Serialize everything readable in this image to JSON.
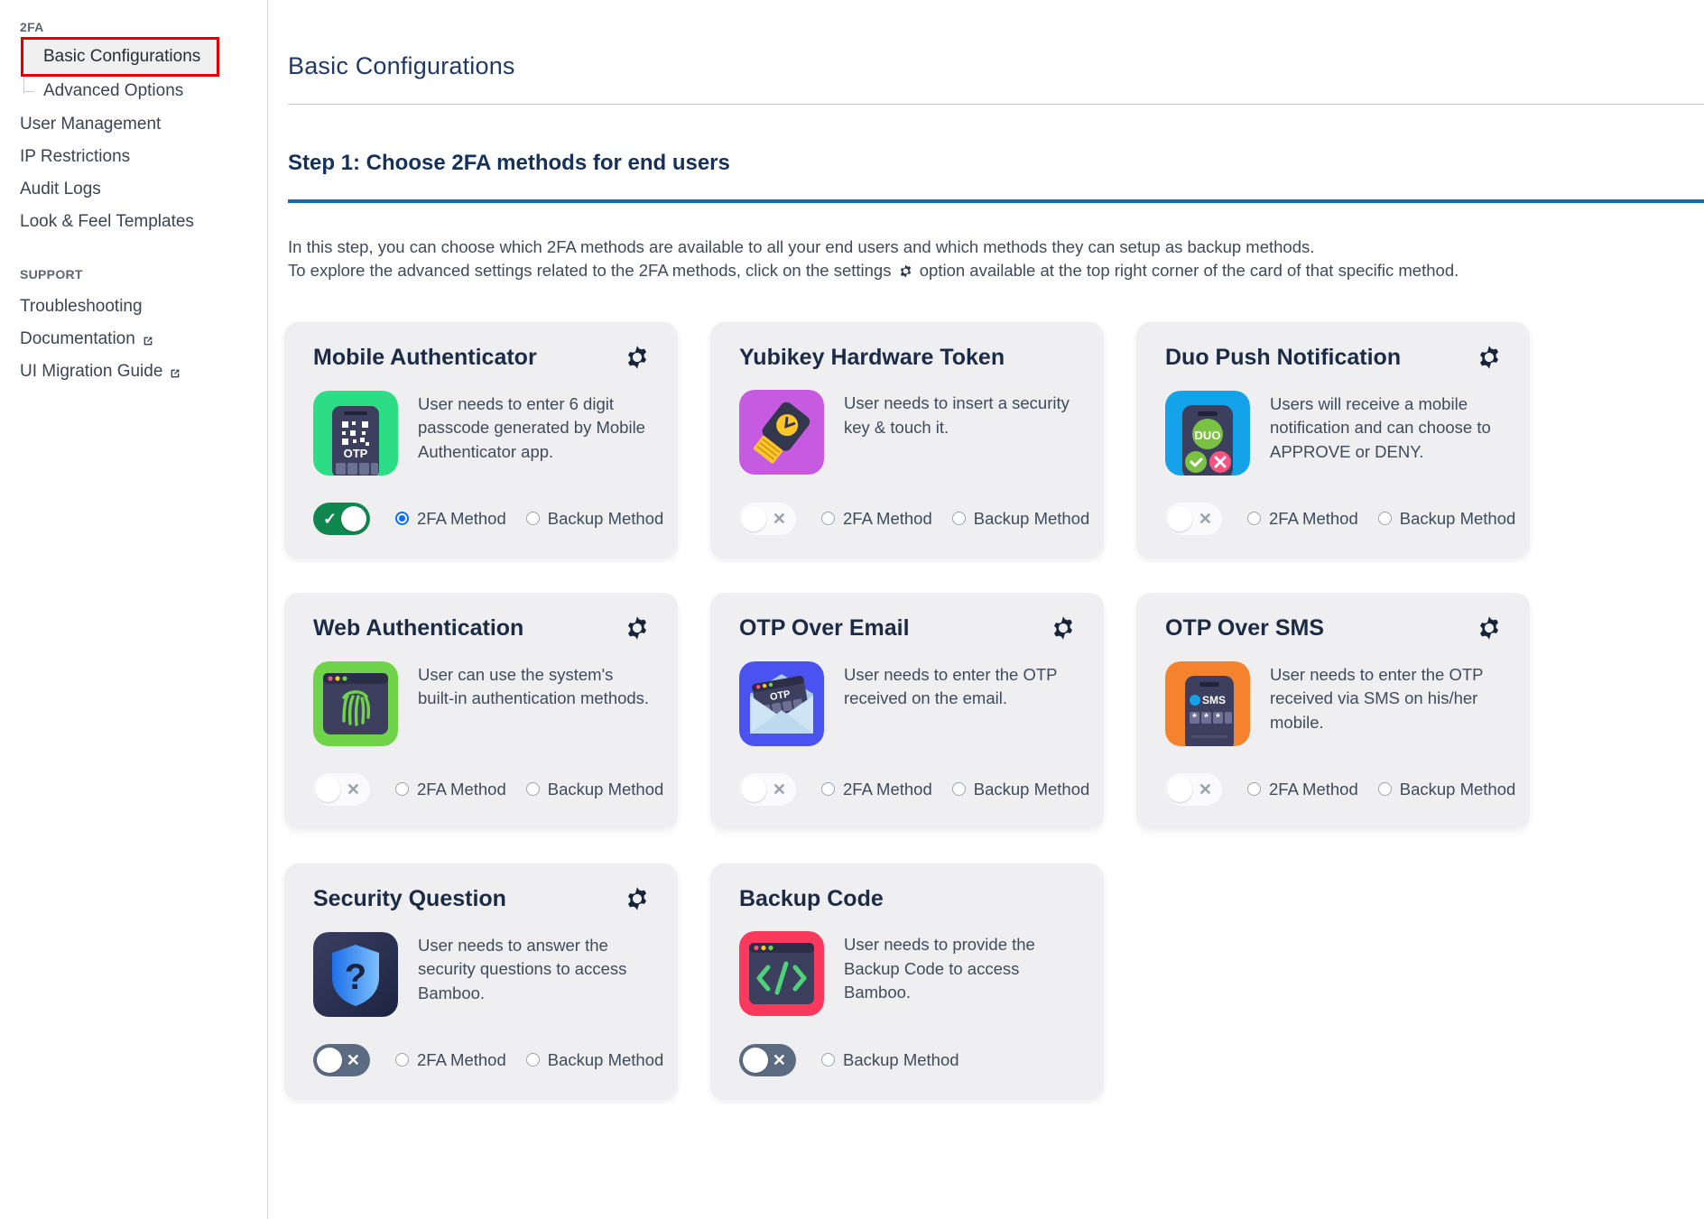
{
  "sidebar": {
    "group_label": "2FA",
    "support_label": "SUPPORT",
    "sub_items": [
      {
        "label": "Basic Configurations",
        "active": true
      },
      {
        "label": "Advanced Options",
        "active": false
      }
    ],
    "items": [
      {
        "label": "User Management",
        "external": false
      },
      {
        "label": "IP Restrictions",
        "external": false
      },
      {
        "label": "Audit Logs",
        "external": false
      },
      {
        "label": "Look & Feel Templates",
        "external": false
      }
    ],
    "support_items": [
      {
        "label": "Troubleshooting",
        "external": false
      },
      {
        "label": "Documentation",
        "external": true
      },
      {
        "label": "UI Migration Guide",
        "external": true
      }
    ]
  },
  "main": {
    "page_title": "Basic Configurations",
    "step_title": "Step 1: Choose 2FA methods for end users",
    "intro_line1": "In this step, you can choose which 2FA methods are available to all your end users and which methods they can setup as backup methods.",
    "intro_line2_a": "To explore the advanced settings related to the 2FA methods, click on the settings",
    "intro_line2_b": "option available at the top right corner of the card of that specific method."
  },
  "labels": {
    "method_2fa": "2FA Method",
    "method_backup": "Backup Method"
  },
  "colors": {
    "accent_blue": "#0f6cbd",
    "title_navy": "#13315c",
    "toggle_on_green": "#10874f",
    "toggle_off_slate": "#5b6b81",
    "radio_blue": "#0d6efd",
    "card_bg": "#efeff2",
    "annotation_red": "#e00000"
  },
  "cards": [
    {
      "title": "Mobile Authenticator",
      "description": "User needs to enter 6 digit passcode generated by Mobile Authenticator app.",
      "has_gear": true,
      "gear_icon": "gear-icon",
      "thumb_icon": "mobile-otp-icon",
      "toggle_state": "on",
      "toggle_mark": "✓",
      "radios": [
        {
          "label": "2FA Method",
          "checked": true
        },
        {
          "label": "Backup Method",
          "checked": false
        }
      ]
    },
    {
      "title": "Yubikey Hardware Token",
      "description": "User needs to insert a security key & touch it.",
      "has_gear": false,
      "gear_icon": "",
      "thumb_icon": "yubikey-token-icon",
      "toggle_state": "off-light",
      "toggle_mark": "✕",
      "radios": [
        {
          "label": "2FA Method",
          "checked": false
        },
        {
          "label": "Backup Method",
          "checked": false
        }
      ]
    },
    {
      "title": "Duo Push Notification",
      "description": "Users will receive a mobile notification and can choose to APPROVE or DENY.",
      "has_gear": true,
      "gear_icon": "gear-icon",
      "thumb_icon": "duo-push-icon",
      "toggle_state": "off-light",
      "toggle_mark": "✕",
      "radios": [
        {
          "label": "2FA Method",
          "checked": false
        },
        {
          "label": "Backup Method",
          "checked": false
        }
      ]
    },
    {
      "title": "Web Authentication",
      "description": "User can use the system's built-in authentication methods.",
      "has_gear": true,
      "gear_icon": "gear-icon",
      "thumb_icon": "fingerprint-window-icon",
      "toggle_state": "off-light",
      "toggle_mark": "✕",
      "radios": [
        {
          "label": "2FA Method",
          "checked": false
        },
        {
          "label": "Backup Method",
          "checked": false
        }
      ]
    },
    {
      "title": "OTP Over Email",
      "description": "User needs to enter the OTP received on the email.",
      "has_gear": true,
      "gear_icon": "gear-icon",
      "thumb_icon": "email-otp-icon",
      "toggle_state": "off-light",
      "toggle_mark": "✕",
      "radios": [
        {
          "label": "2FA Method",
          "checked": false
        },
        {
          "label": "Backup Method",
          "checked": false
        }
      ]
    },
    {
      "title": "OTP Over SMS",
      "description": "User needs to enter the OTP received via SMS on his/her mobile.",
      "has_gear": true,
      "gear_icon": "gear-icon",
      "thumb_icon": "sms-otp-icon",
      "toggle_state": "off-light",
      "toggle_mark": "✕",
      "radios": [
        {
          "label": "2FA Method",
          "checked": false
        },
        {
          "label": "Backup Method",
          "checked": false
        }
      ]
    },
    {
      "title": "Security Question",
      "description": "User needs to answer the security questions to access Bamboo.",
      "has_gear": true,
      "gear_icon": "gear-icon",
      "thumb_icon": "shield-question-icon",
      "toggle_state": "off-dark",
      "toggle_mark": "✕",
      "radios": [
        {
          "label": "2FA Method",
          "checked": false
        },
        {
          "label": "Backup Method",
          "checked": false
        }
      ]
    },
    {
      "title": "Backup Code",
      "description": "User needs to provide the Backup Code to access Bamboo.",
      "has_gear": false,
      "gear_icon": "",
      "thumb_icon": "code-window-icon",
      "toggle_state": "off-dark",
      "toggle_mark": "✕",
      "radios": [
        {
          "label": "Backup Method",
          "checked": false
        }
      ]
    }
  ]
}
